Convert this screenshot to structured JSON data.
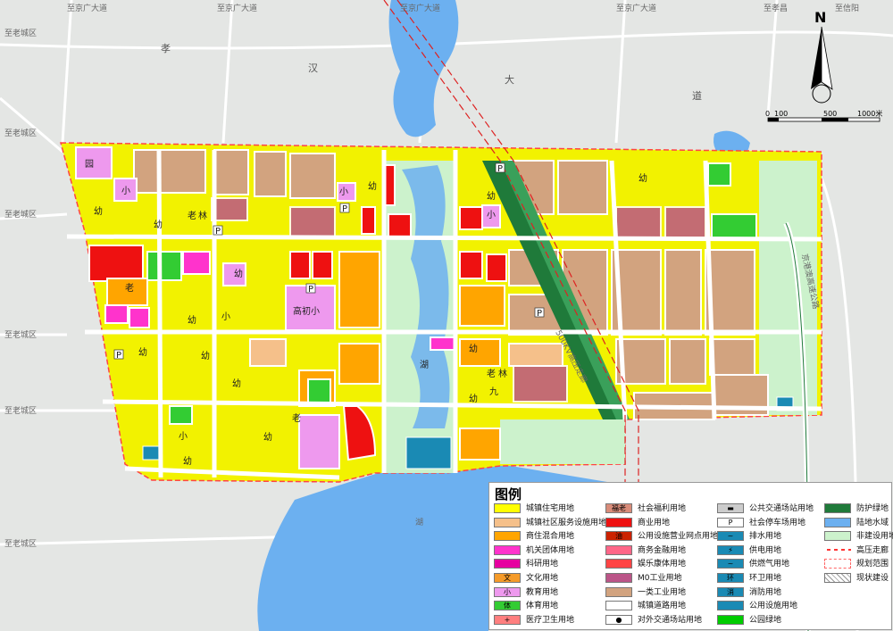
{
  "roads": {
    "top_left": "至京广大道",
    "top_mid1": "至京广大道",
    "top_mid2": "至京广大道",
    "top_right1": "至京广大道",
    "top_right2": "至孝昌",
    "top_right3": "至信阳",
    "left1": "至老城区",
    "left2": "至老城区",
    "left3": "至老城区",
    "left4": "至老城区",
    "left5": "至老城区",
    "expressway": "京港澳高速公路",
    "corridor": "500KV高压走廊",
    "lake": "湖"
  },
  "road_chars": {
    "xiao": "孝",
    "han": "汉",
    "da": "大",
    "dao": "道"
  },
  "labels": {
    "yuan": "园",
    "xiao1": "小",
    "you": "幼",
    "lao": "老",
    "lin": "林",
    "gaochu": "高初小",
    "hu": "湖",
    "fu_lao": "福 老",
    "jiu": "九",
    "p": "P"
  },
  "scale": {
    "zero": "0",
    "s100": "100",
    "s500": "500",
    "s1000": "1000米"
  },
  "north": "N",
  "legend": {
    "title": "图例",
    "col1": [
      {
        "label": "城镇住宅用地",
        "color": "#ffff00"
      },
      {
        "label": "城镇社区服务设施用地",
        "color": "#f5c08a"
      },
      {
        "label": "商住混合用地",
        "color": "#ffa500"
      },
      {
        "label": "机关团体用地",
        "color": "#ff33cc"
      },
      {
        "label": "科研用地",
        "color": "#e600a0"
      },
      {
        "label": "文化用地",
        "color": "#f59b2a",
        "tag": "文"
      },
      {
        "label": "教育用地",
        "color": "#ee99ee",
        "tag": "小"
      },
      {
        "label": "体育用地",
        "color": "#33cc33",
        "tag": "体"
      },
      {
        "label": "医疗卫生用地",
        "color": "#ff7f7f",
        "tag": "+"
      }
    ],
    "col2": [
      {
        "label": "社会福利用地",
        "color": "#d98c7a",
        "tag": "福老"
      },
      {
        "label": "商业用地",
        "color": "#ee1111"
      },
      {
        "label": "公用设施营业网点用地",
        "color": "#cc2200",
        "tag": "油"
      },
      {
        "label": "商务金融用地",
        "color": "#ff6688"
      },
      {
        "label": "娱乐康体用地",
        "color": "#ff4444"
      },
      {
        "label": "M0工业用地",
        "color": "#bb5588"
      },
      {
        "label": "一类工业用地",
        "color": "#d2a37f"
      },
      {
        "label": "城镇道路用地",
        "color": "#ffffff"
      },
      {
        "label": "对外交通场站用地",
        "color": "#ffffff",
        "tag": "●"
      }
    ],
    "col3": [
      {
        "label": "公共交通场站用地",
        "color": "#cccccc",
        "tag": "▬"
      },
      {
        "label": "社会停车场用地",
        "color": "#ffffff",
        "tag": "P"
      },
      {
        "label": "排水用地",
        "color": "#1a8ab4",
        "tag": "~"
      },
      {
        "label": "供电用地",
        "color": "#1a8ab4",
        "tag": "⚡"
      },
      {
        "label": "供燃气用地",
        "color": "#1a8ab4",
        "tag": "~"
      },
      {
        "label": "环卫用地",
        "color": "#1a8ab4",
        "tag": "环"
      },
      {
        "label": "消防用地",
        "color": "#1a8ab4",
        "tag": "消"
      },
      {
        "label": "公用设施用地",
        "color": "#1a8ab4"
      },
      {
        "label": "公园绿地",
        "color": "#00cc00"
      }
    ],
    "col4": [
      {
        "label": "防护绿地",
        "color": "#1f7a3a"
      },
      {
        "label": "陆地水域",
        "color": "#6cb0f0"
      },
      {
        "label": "非建设用地",
        "color": "#ccf2cc"
      },
      {
        "label": "高压走廊",
        "color": "#ff3333",
        "line": "dash"
      },
      {
        "label": "规划范围",
        "color": "#ff6666",
        "line": "box"
      },
      {
        "label": "现状建设",
        "color": "#ffffff",
        "line": "hatch"
      }
    ]
  }
}
